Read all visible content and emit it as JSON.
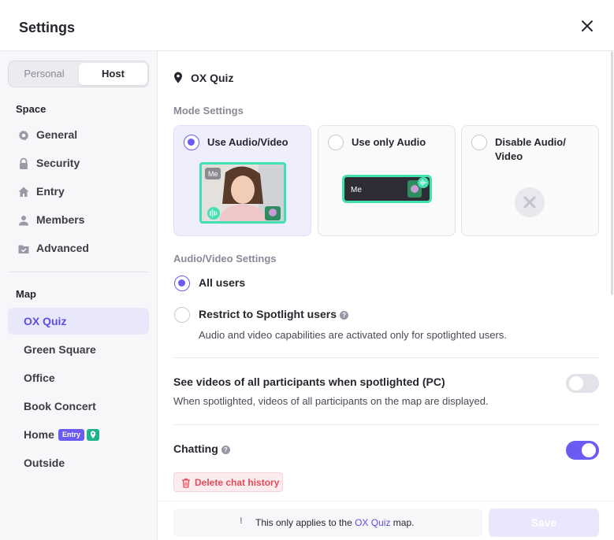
{
  "dialog": {
    "title": "Settings"
  },
  "sidebar": {
    "tabs": {
      "personal": "Personal",
      "host": "Host",
      "selected": "Host"
    },
    "space_title": "Space",
    "space_items": [
      {
        "label": "General",
        "icon": "gear-icon"
      },
      {
        "label": "Security",
        "icon": "lock-icon"
      },
      {
        "label": "Entry",
        "icon": "home-icon"
      },
      {
        "label": "Members",
        "icon": "person-icon"
      },
      {
        "label": "Advanced",
        "icon": "folder-check-icon"
      }
    ],
    "map_title": "Map",
    "map_items": [
      {
        "label": "OX Quiz",
        "active": true
      },
      {
        "label": "Green Square"
      },
      {
        "label": "Office"
      },
      {
        "label": "Book Concert"
      },
      {
        "label": "Home",
        "badge": "Entry",
        "pin_icon": "map-pin-icon"
      },
      {
        "label": "Outside"
      }
    ]
  },
  "main": {
    "map_name": "OX Quiz",
    "mode_settings_label": "Mode Settings",
    "mode_options": [
      {
        "label": "Use Audio/Video",
        "selected": true,
        "preview_tag": "Me"
      },
      {
        "label": "Use only Audio",
        "selected": false,
        "preview_tag": "Me"
      },
      {
        "label_line1": "Disable Audio/",
        "label_line2": "Video",
        "selected": false
      }
    ],
    "av_settings_label": "Audio/Video Settings",
    "av_options": [
      {
        "label": "All users",
        "selected": true
      },
      {
        "label": "Restrict to Spotlight users",
        "selected": false,
        "help": "?"
      }
    ],
    "restrict_description": "Audio and video capabilities are activated only for spotlighted users.",
    "spotlight_videos": {
      "title": "See videos of all participants when spotlighted (PC)",
      "description": "When spotlighted, videos of all participants on the map are displayed.",
      "enabled": false
    },
    "chatting": {
      "title": "Chatting",
      "help": "?",
      "enabled": true
    },
    "delete_chat_label": "Delete chat history"
  },
  "footer": {
    "notice_icon": "!",
    "notice_prefix": "This only applies to the",
    "notice_map": "OX Quiz",
    "notice_suffix": "map.",
    "save_label": "Save",
    "save_enabled": false
  },
  "colors": {
    "accent": "#6b5bf0",
    "danger": "#e44a5a",
    "preview_border": "#43e0b2",
    "pin_badge": "#1fb28f"
  }
}
